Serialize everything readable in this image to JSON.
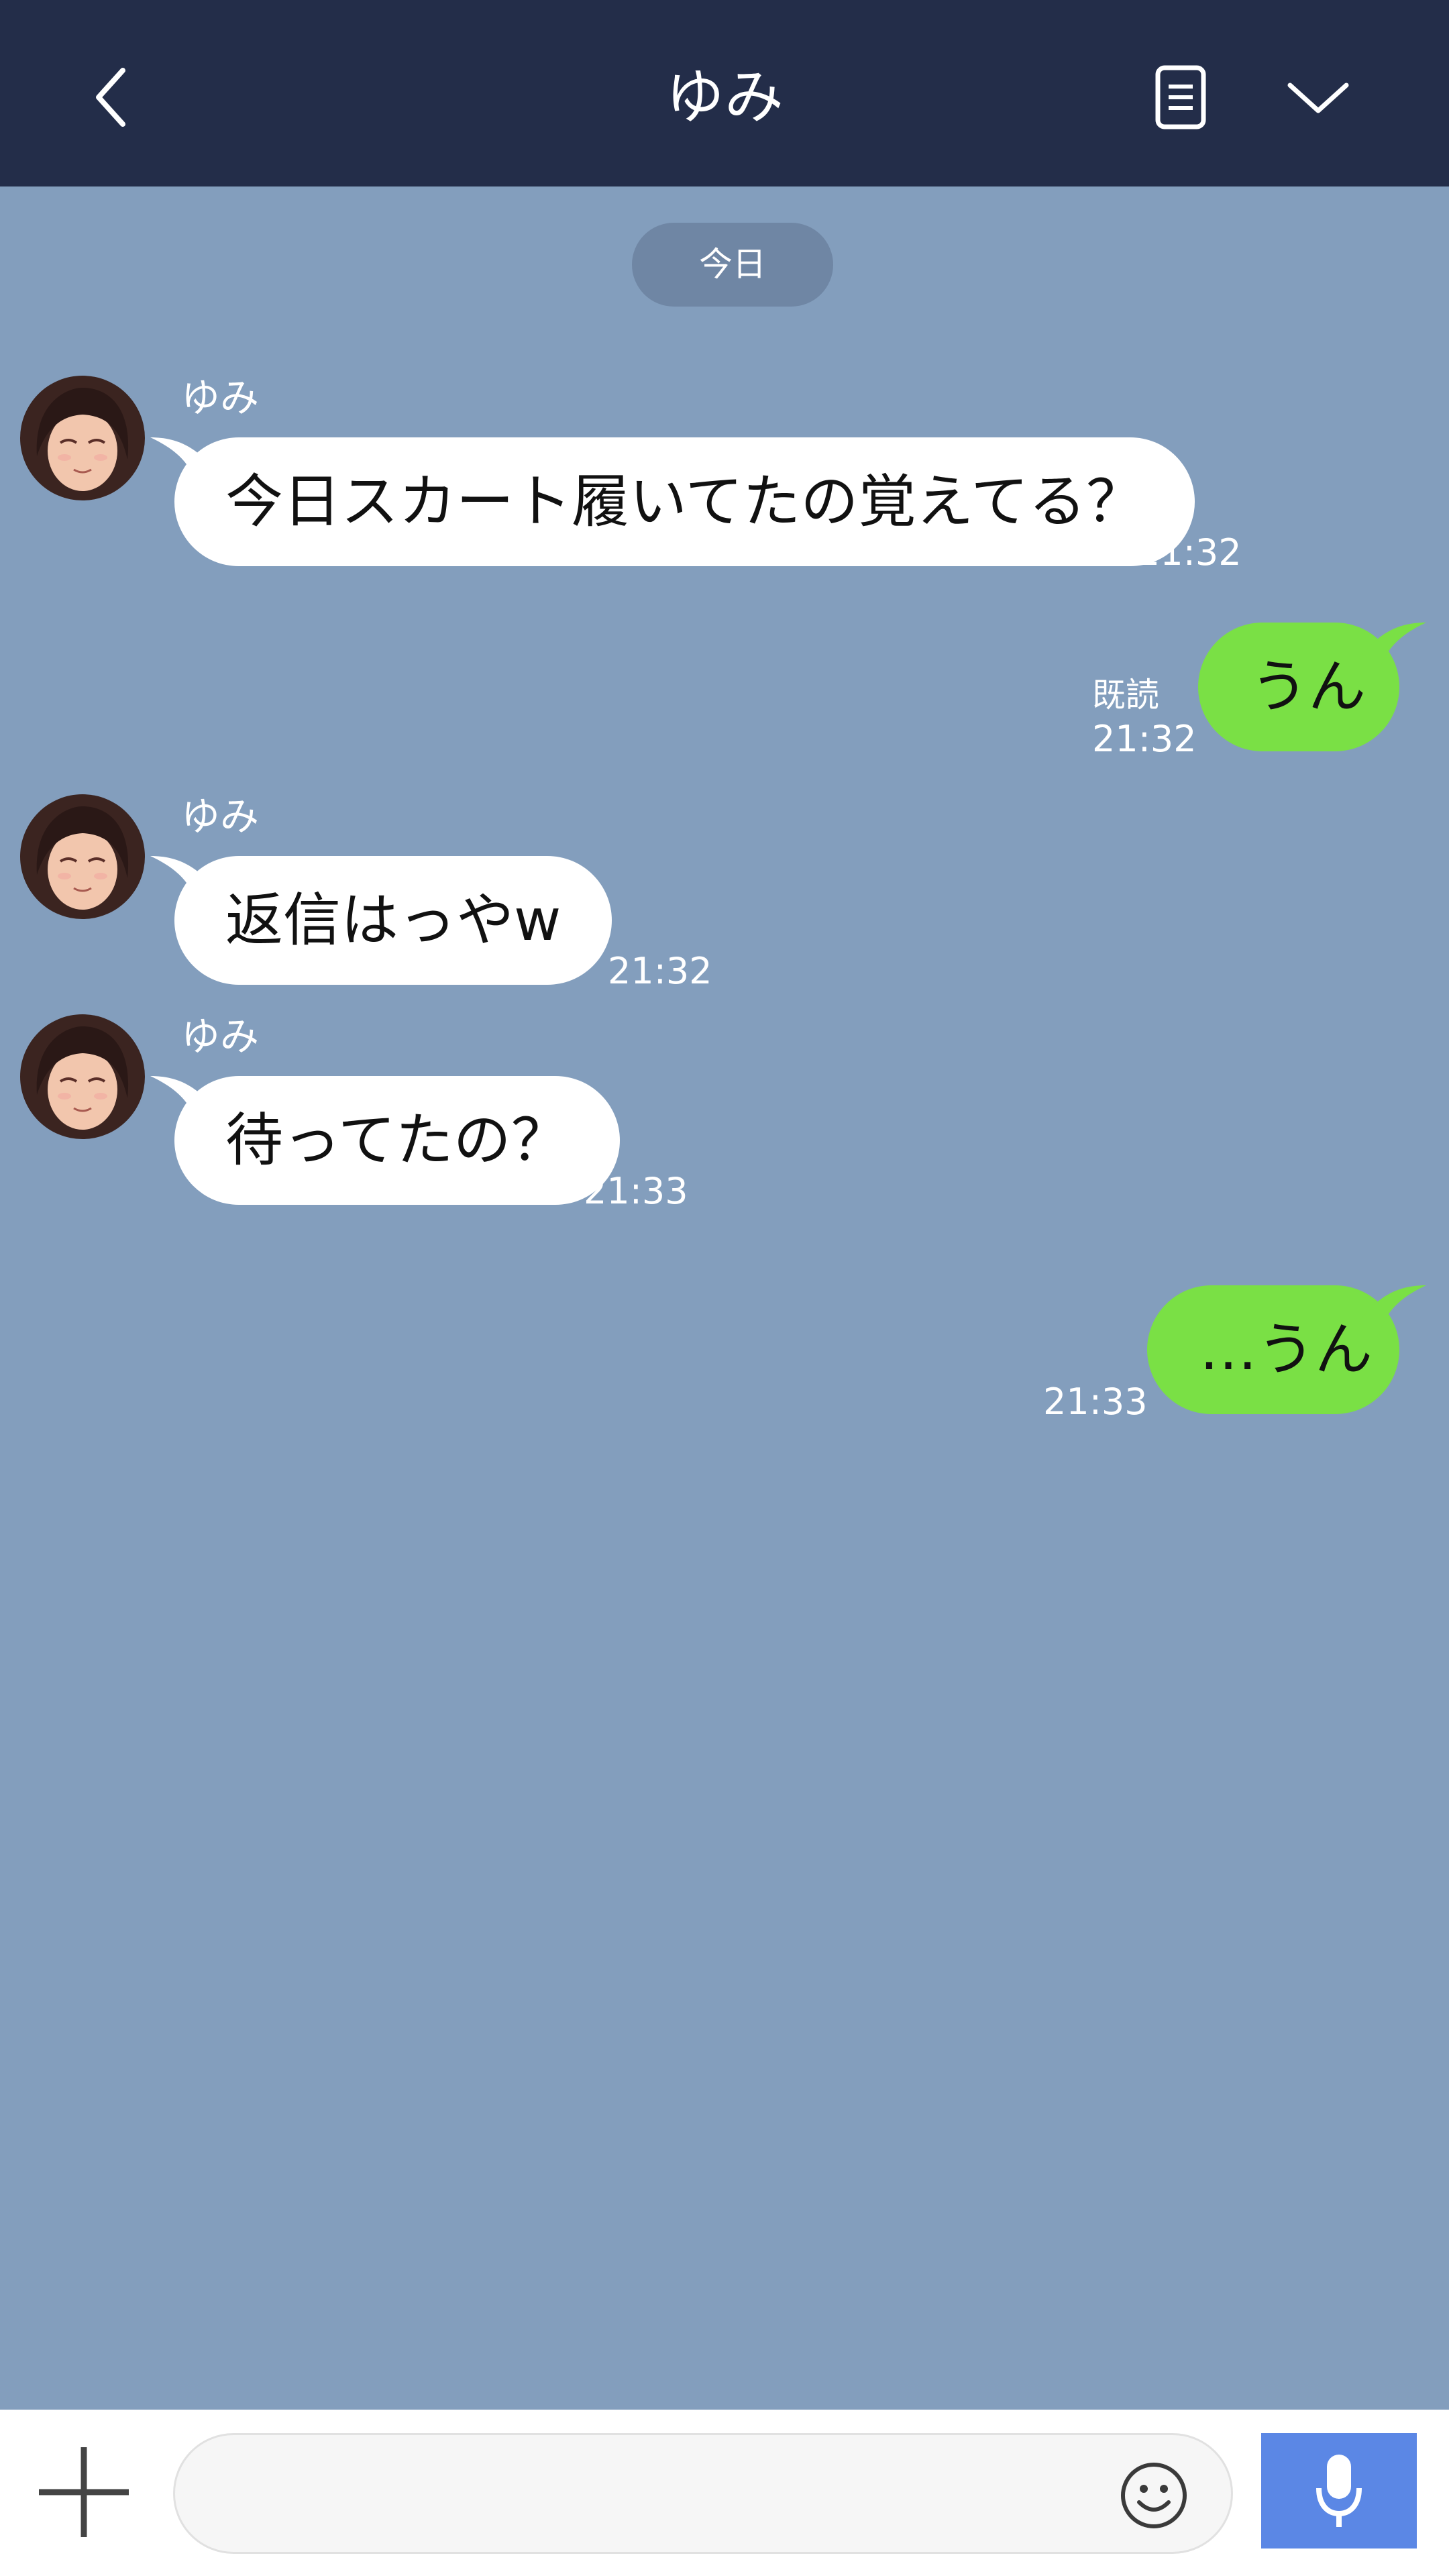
{
  "header": {
    "title": "ゆみ",
    "back_icon": "chevron-left-icon",
    "notes_icon": "note-icon",
    "menu_icon": "chevron-down-icon",
    "background": "#232d49"
  },
  "chat": {
    "background": "#839ebd",
    "date_divider": "今日",
    "messages": [
      {
        "direction": "incoming",
        "sender": "ゆみ",
        "text": "今日スカート履いてたの覚えてる？",
        "time": "21:32"
      },
      {
        "direction": "outgoing",
        "text": "うん",
        "time": "21:32",
        "read_label": "既読"
      },
      {
        "direction": "incoming",
        "sender": "ゆみ",
        "text": "返信はっやw",
        "time": "21:32"
      },
      {
        "direction": "incoming",
        "sender": "ゆみ",
        "text": "待ってたの？",
        "time": "21:33"
      },
      {
        "direction": "outgoing",
        "text": "…うん",
        "time": "21:33"
      }
    ],
    "incoming_bubble_color": "#ffffff",
    "outgoing_bubble_color": "#7ae045"
  },
  "composer": {
    "plus_icon": "plus-icon",
    "input_value": "",
    "input_placeholder": "",
    "emoji_icon": "smiley-icon",
    "mic_icon": "microphone-icon",
    "mic_color": "#5b87e5"
  }
}
